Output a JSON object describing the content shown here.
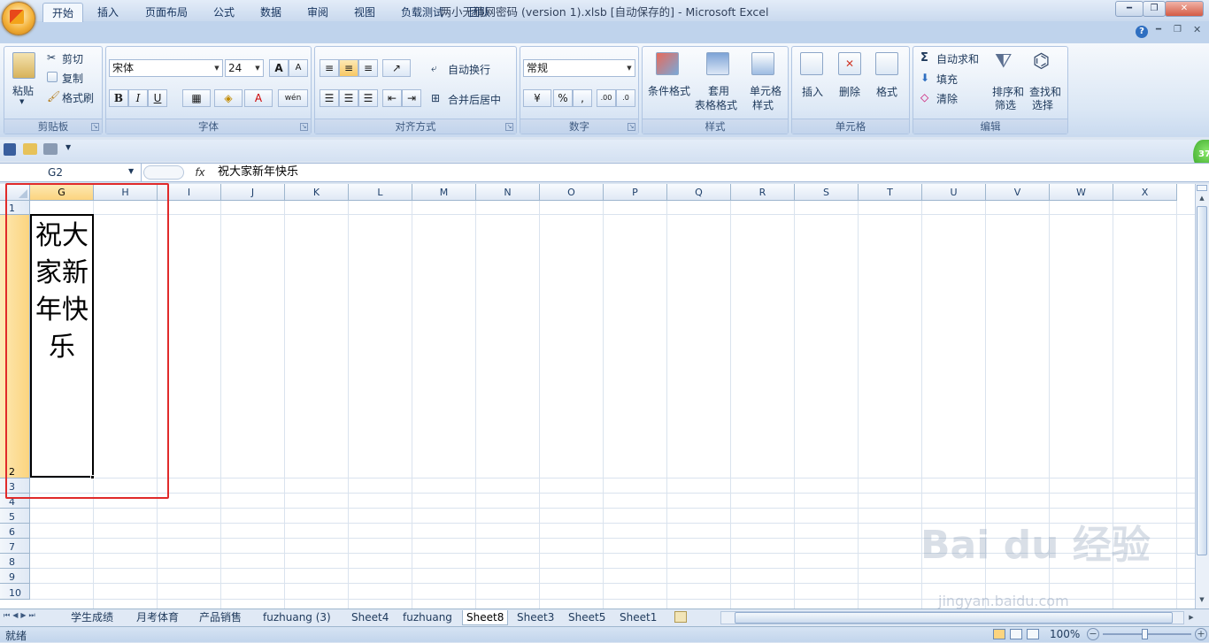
{
  "window": {
    "title": "两小无猜网密码 (version 1).xlsb [自动保存的] - Microsoft Excel"
  },
  "tabs": [
    "开始",
    "插入",
    "页面布局",
    "公式",
    "数据",
    "审阅",
    "视图",
    "负载测试",
    "团队"
  ],
  "ribbon": {
    "clipboard": {
      "label": "剪贴板",
      "paste": "粘贴",
      "cut": "剪切",
      "copy": "复制",
      "format_painter": "格式刷"
    },
    "font": {
      "label": "字体",
      "name": "宋体",
      "size": "24",
      "bold": "B",
      "italic": "I",
      "underline": "U",
      "grow": "A",
      "shrink": "A",
      "font_color": "A",
      "phonetic": "wén"
    },
    "alignment": {
      "label": "对齐方式",
      "wrap": "自动换行",
      "merge": "合并后居中"
    },
    "number": {
      "label": "数字",
      "format": "常规",
      "percent": "%",
      "comma": ","
    },
    "styles": {
      "label": "样式",
      "conditional": "条件格式",
      "table_1": "套用",
      "table_2": "表格格式",
      "cell_styles_1": "单元格",
      "cell_styles_2": "样式"
    },
    "cells": {
      "label": "单元格",
      "insert": "插入",
      "delete": "删除",
      "format": "格式"
    },
    "editing": {
      "label": "编辑",
      "autosum": "自动求和",
      "fill": "填充",
      "clear": "清除",
      "sort_1": "排序和",
      "sort_2": "筛选",
      "find_1": "查找和",
      "find_2": "选择"
    }
  },
  "formula_bar": {
    "name_box": "G2",
    "fx": "fx",
    "content": "祝大家新年快乐"
  },
  "columns": [
    "G",
    "H",
    "I",
    "J",
    "K",
    "L",
    "M",
    "N",
    "O",
    "P",
    "Q",
    "R",
    "S",
    "T",
    "U",
    "V",
    "W",
    "X"
  ],
  "rows": [
    "1",
    "2",
    "3",
    "4",
    "5",
    "6",
    "7",
    "8",
    "9",
    "10"
  ],
  "cell_G2": "祝大家新年快乐",
  "sheets": [
    "学生成绩",
    "月考体育",
    "产品销售",
    "fuzhuang (3)",
    "Sheet4",
    "fuzhuang",
    "Sheet8",
    "Sheet3",
    "Sheet5",
    "Sheet1"
  ],
  "active_sheet": "Sheet8",
  "status": {
    "ready": "就绪",
    "zoom": "100%"
  },
  "badge": "37",
  "watermark": {
    "brand": "Bai du 经验",
    "url": "jingyan.baidu.com"
  }
}
